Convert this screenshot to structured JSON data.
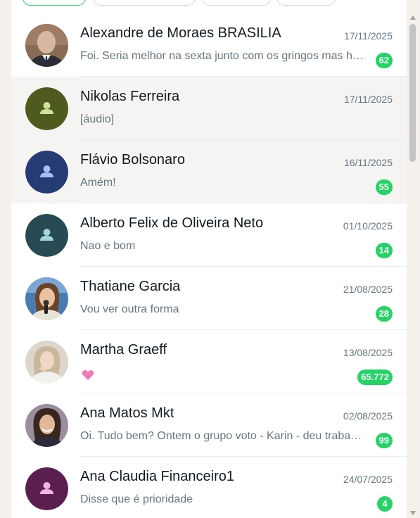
{
  "chats": [
    {
      "name": "Alexandre de Moraes BRASILIA",
      "date": "17/11/2025",
      "preview": "Foi. Seria melhor na sexta junto com os gringos mas hoje está bom",
      "badge": "62",
      "avatar": "photo-man"
    },
    {
      "name": "Nikolas Ferreira",
      "date": "17/11/2025",
      "preview": "[áudio]",
      "badge": "",
      "avatar": "default-olive"
    },
    {
      "name": "Flávio Bolsonaro",
      "date": "16/11/2025",
      "preview": "Amém!",
      "badge": "55",
      "avatar": "default-navy"
    },
    {
      "name": "Alberto Felix de Oliveira Neto",
      "date": "01/10/2025",
      "preview": "Nao e bom",
      "badge": "14",
      "avatar": "default-teal"
    },
    {
      "name": "Thatiane Garcia",
      "date": "21/08/2025",
      "preview": "Vou ver outra forma",
      "badge": "28",
      "avatar": "photo-woman-mic"
    },
    {
      "name": "Martha Graeff",
      "date": "13/08/2025",
      "preview": "",
      "badge": "65.772",
      "avatar": "photo-woman-blonde",
      "preview_icon": "heart-icon"
    },
    {
      "name": "Ana Matos Mkt",
      "date": "02/08/2025",
      "preview": "Oi. Tudo bem? Ontem o grupo voto - Karin - deu trabalho",
      "badge": "99",
      "avatar": "photo-woman-dark"
    },
    {
      "name": "Ana Claudia Financeiro1",
      "date": "24/07/2025",
      "preview": "Disse que é prioridade",
      "badge": "4",
      "avatar": "default-plum"
    }
  ],
  "colors": {
    "badge": "#25d366",
    "name": "#111b21",
    "secondary": "#667781",
    "hover_row": "#f5f4f2",
    "heart": "#f07ab8"
  }
}
